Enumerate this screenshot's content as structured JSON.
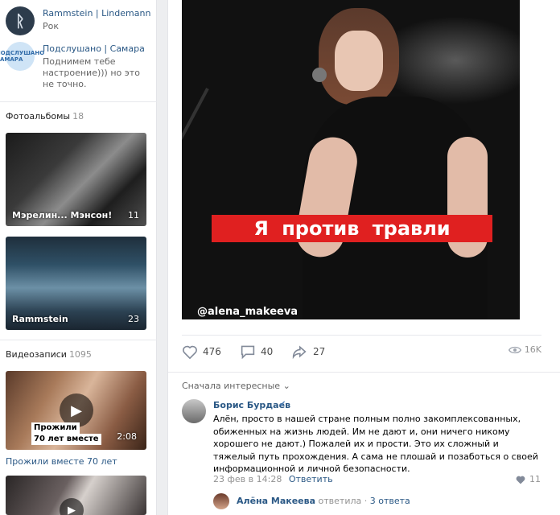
{
  "groups": [
    {
      "name": "Rammstein | Lindemann",
      "sub": "Рок"
    },
    {
      "name": "Подслушано | Самара",
      "sub": "Поднимем тебе настроение))) но это не точно.",
      "avatar_text": "ПОДСЛУШАНО САМАРА"
    }
  ],
  "albums": {
    "title": "Фотоальбомы",
    "count": "18",
    "items": [
      {
        "caption": "Мэрелин... Мэнсон!",
        "count": "11"
      },
      {
        "caption": "Rammstein",
        "count": "23"
      }
    ]
  },
  "videos": {
    "title": "Видеозаписи",
    "count": "1095",
    "items": [
      {
        "label_line1": "Прожили",
        "label_line2": "70 лет вместе",
        "duration": "2:08",
        "title": "Прожили вместе 70 лет"
      }
    ]
  },
  "post": {
    "banner_text": "Я против травли",
    "handle": "@alena_makeeva",
    "likes": "476",
    "comments": "40",
    "shares": "27",
    "views": "16K"
  },
  "comments": {
    "sort_label": "Сначала интересные",
    "items": [
      {
        "author": "Борис Бурдаев",
        "text": "Алён, просто в нашей стране полным полно закомплексованных, обиженных на жизнь людей. Им не дают и, они ничего никому хорошего не дают.) Пожалей их и прости. Это их сложный и тяжелый путь прохождения. А сама не плошай и позаботься о своей информационной и личной безопасности.",
        "date": "23 фев в 14:28",
        "reply_label": "Ответить",
        "likes": "11",
        "reply_author": "Алёна Макеева",
        "reply_action": "ответила",
        "reply_count": "3 ответа"
      }
    ]
  },
  "colors": {
    "link": "#2a5885",
    "banner": "#e02020",
    "muted": "#939393"
  }
}
